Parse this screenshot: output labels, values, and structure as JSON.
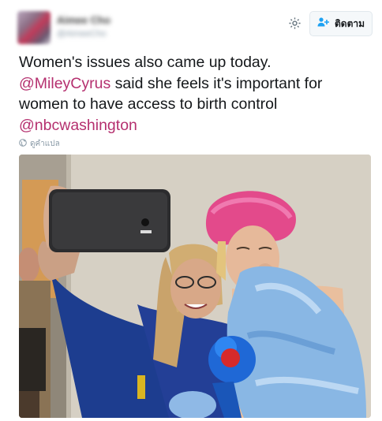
{
  "author": {
    "name": "Aimee Cho",
    "handle": "@AimeeCho"
  },
  "actions": {
    "follow_label": "ติดตาม"
  },
  "tweet": {
    "line1": "Women's issues also came up today.",
    "mention1": "@MileyCyrus",
    "line2_rest": " said she feels it's important for",
    "line3": "women to have access to birth control",
    "mention2": "@nbcwashington"
  },
  "translate": {
    "label": "ดูคำแปล"
  },
  "icons": {
    "settings": "gear-icon",
    "follow": "add-user-icon",
    "translate": "globe-icon"
  },
  "colors": {
    "mention": "#b5306f",
    "follow_icon": "#1da1f2"
  }
}
